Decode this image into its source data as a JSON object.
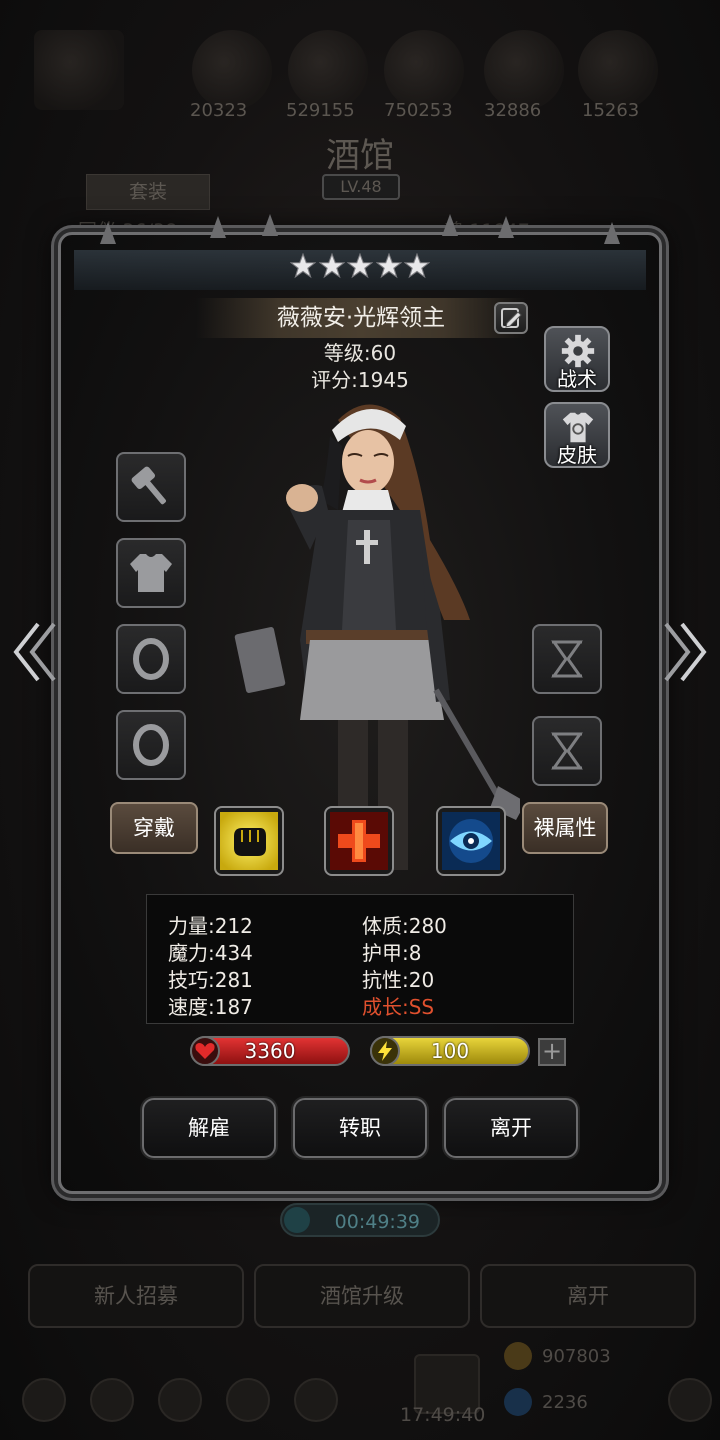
{
  "background": {
    "resources": [
      "20323",
      "529155",
      "750253",
      "32886",
      "15263"
    ],
    "title": "酒馆",
    "level": "LV.48",
    "set_button": "套装",
    "roster_label": "同伴:36/38",
    "soul_label": "魂:11947",
    "timer": "00:49:39",
    "bottom_buttons": [
      "新人招募",
      "酒馆升级",
      "离开"
    ],
    "gold": "907803",
    "gems": "2236",
    "clock": "17:49:40"
  },
  "hero": {
    "stars": 5,
    "name": "薇薇安·光辉领主",
    "level_line": "等级:60",
    "score_line": "评分:1945"
  },
  "side_buttons": {
    "tactics": "战术",
    "skin": "皮肤"
  },
  "equip_button": "穿戴",
  "naked_stats_button": "裸属性",
  "stats": {
    "strength": "力量:212",
    "magic": "魔力:434",
    "skill": "技巧:281",
    "speed": "速度:187",
    "constitution": "体质:280",
    "armor": "护甲:8",
    "resistance": "抗性:20",
    "growth": "成长:SS"
  },
  "bars": {
    "hp": "3360",
    "energy": "100"
  },
  "plus_label": "+",
  "actions": {
    "dismiss": "解雇",
    "change_class": "转职",
    "leave": "离开"
  },
  "colors": {
    "hp_bar": "#c41a1a",
    "energy_bar": "#c9b51d",
    "growth_text": "#e0502e"
  }
}
